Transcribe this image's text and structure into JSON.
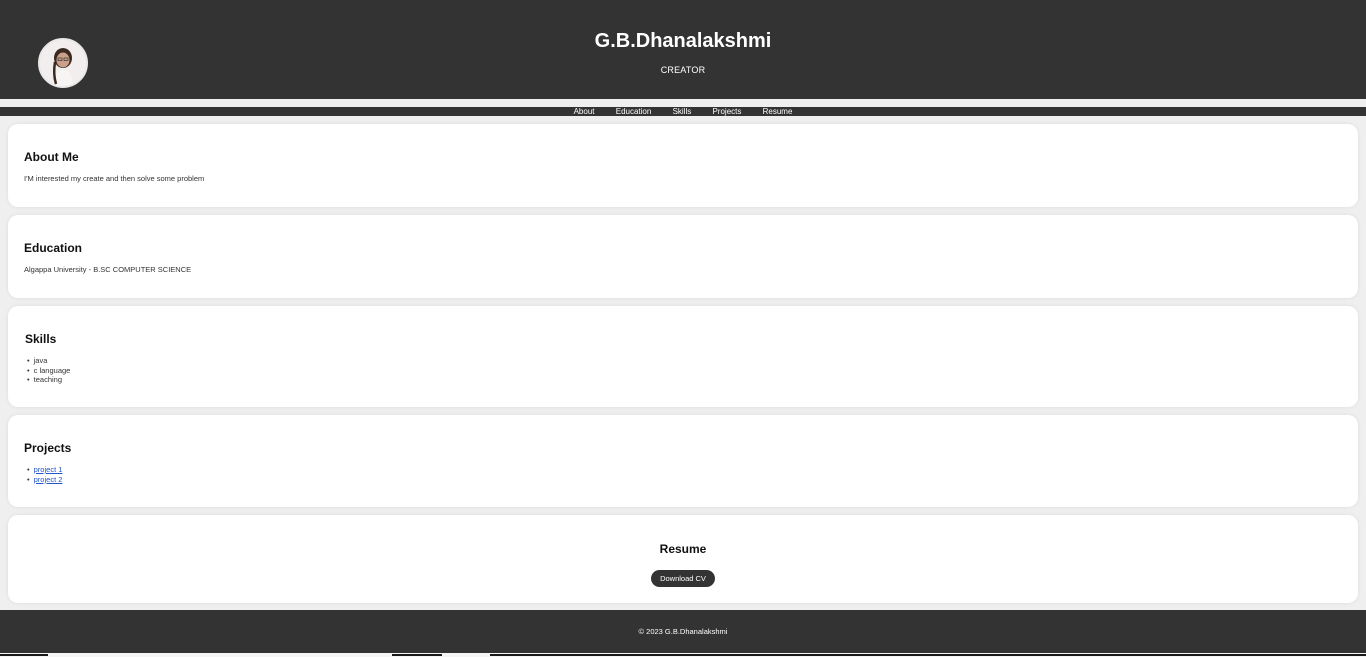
{
  "header": {
    "avatar_alt": "profile photo",
    "name": "G.B.Dhanalakshmi",
    "subtitle": "CREATOR"
  },
  "nav": {
    "items": [
      "About",
      "Education",
      "Skills",
      "Projects",
      "Resume"
    ]
  },
  "about": {
    "title": "About Me",
    "text": "I'M interested my create and then solve some problem"
  },
  "education": {
    "title": "Education",
    "text": "Algappa University - B.SC COMPUTER SCIENCE"
  },
  "skills": {
    "title": "Skills",
    "items": [
      "java",
      "c language",
      "teaching"
    ]
  },
  "projects": {
    "title": "Projects",
    "items": [
      "project 1",
      "project 2"
    ]
  },
  "resume": {
    "title": "Resume",
    "button_label": "Download CV"
  },
  "footer": {
    "text": "© 2023 G.B.Dhanalakshmi"
  },
  "colors": {
    "header_bg": "#333333",
    "page_bg": "#efefef",
    "link": "#2255cc"
  }
}
